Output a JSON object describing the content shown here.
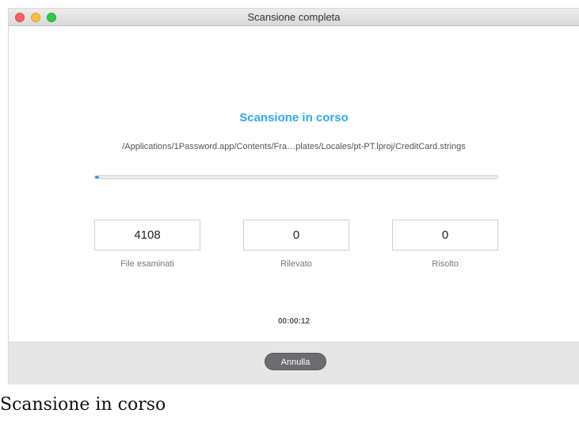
{
  "window": {
    "title": "Scansione completa"
  },
  "scan": {
    "heading": "Scansione in corso",
    "current_path": "/Applications/1Password.app/Contents/Fra…plates/Locales/pt-PT.lproj/CreditCard.strings",
    "progress_percent": 1,
    "elapsed": "00:00:12",
    "accent_color": "#2eaaf0"
  },
  "stats": [
    {
      "value": "4108",
      "label": "File esaminati"
    },
    {
      "value": "0",
      "label": "Rilevato"
    },
    {
      "value": "0",
      "label": "Risolto"
    }
  ],
  "footer": {
    "cancel_label": "Annulla"
  },
  "caption": "Scansione in corso"
}
